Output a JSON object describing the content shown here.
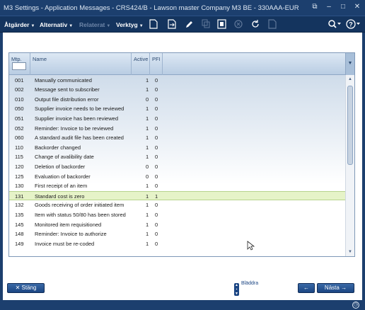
{
  "window": {
    "title": "M3 Settings - Application Messages - CRS424/B - Lawson master Company M3 BE - 330AAA-EUR",
    "buttons": {
      "restore_icon": "⧉",
      "minimize_icon": "–",
      "maximize_icon": "□",
      "close_icon": "✕"
    }
  },
  "toolbar": {
    "menus": {
      "actions": "Åtgärder",
      "alternative": "Alternativ",
      "related": "Relaterat",
      "tools": "Verktyg"
    },
    "icons": [
      "new",
      "open",
      "edit",
      "copy",
      "display",
      "delete",
      "refresh",
      "print"
    ],
    "zoom_icon": "🔍",
    "help_icon": "?"
  },
  "grid": {
    "columns": {
      "mtp": "Mtp.",
      "name": "Name",
      "active": "Active",
      "pfi": "PFI"
    },
    "filter_value": "",
    "rows": [
      {
        "mtp": "001",
        "name": "Manually communicated",
        "active": "1",
        "pfi": "0",
        "selected": false
      },
      {
        "mtp": "002",
        "name": "Message sent to subscriber",
        "active": "1",
        "pfi": "0",
        "selected": false
      },
      {
        "mtp": "010",
        "name": "Output file distribution error",
        "active": "0",
        "pfi": "0",
        "selected": false
      },
      {
        "mtp": "050",
        "name": "Supplier invoice needs to be reviewed",
        "active": "1",
        "pfi": "0",
        "selected": false
      },
      {
        "mtp": "051",
        "name": "Supplier invoice has been reviewed",
        "active": "1",
        "pfi": "0",
        "selected": false
      },
      {
        "mtp": "052",
        "name": "Reminder: Invoice to be reviewed",
        "active": "1",
        "pfi": "0",
        "selected": false
      },
      {
        "mtp": "060",
        "name": "A standard audit file has been created",
        "active": "1",
        "pfi": "0",
        "selected": false
      },
      {
        "mtp": "110",
        "name": "Backorder changed",
        "active": "1",
        "pfi": "0",
        "selected": false
      },
      {
        "mtp": "115",
        "name": "Change of avalibility date",
        "active": "1",
        "pfi": "0",
        "selected": false
      },
      {
        "mtp": "120",
        "name": "Deletion of backorder",
        "active": "0",
        "pfi": "0",
        "selected": false
      },
      {
        "mtp": "125",
        "name": "Evaluation of backorder",
        "active": "0",
        "pfi": "0",
        "selected": false
      },
      {
        "mtp": "130",
        "name": "First receipt of an item",
        "active": "1",
        "pfi": "0",
        "selected": false
      },
      {
        "mtp": "131",
        "name": "Standard cost is zero",
        "active": "1",
        "pfi": "1",
        "selected": true
      },
      {
        "mtp": "132",
        "name": "Goods receiving of order initiated item",
        "active": "1",
        "pfi": "0",
        "selected": false
      },
      {
        "mtp": "135",
        "name": "Item with status 50/80 has been stored",
        "active": "1",
        "pfi": "0",
        "selected": false
      },
      {
        "mtp": "145",
        "name": "Monitored item requisitioned",
        "active": "1",
        "pfi": "0",
        "selected": false
      },
      {
        "mtp": "148",
        "name": "Reminder: Invoice to authorize",
        "active": "1",
        "pfi": "0",
        "selected": false
      },
      {
        "mtp": "149",
        "name": "Invoice must be re-coded",
        "active": "1",
        "pfi": "0",
        "selected": false
      }
    ]
  },
  "footer": {
    "close_label": "Stäng",
    "browse_label": "Bläddra",
    "next_label": "Nästa",
    "back_icon": "←",
    "next_icon": "→"
  },
  "colors": {
    "accent": "#1c3f6e",
    "selected_row": "#e6f3c8",
    "button": "#1b4583"
  }
}
